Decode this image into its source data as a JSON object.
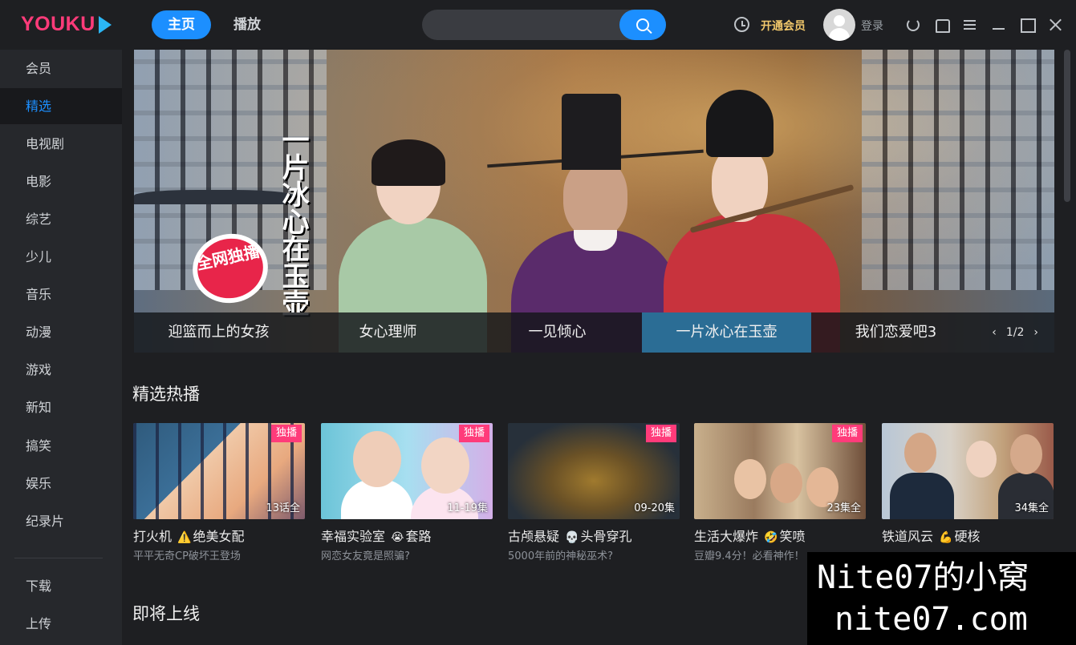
{
  "app": {
    "logo_text": "YOUKU",
    "nav": {
      "home": "主页",
      "play": "播放"
    },
    "vip_label": "开通会员",
    "login_label": "登录"
  },
  "sidebar": {
    "items": [
      "会员",
      "精选",
      "电视剧",
      "电影",
      "综艺",
      "少儿",
      "音乐",
      "动漫",
      "游戏",
      "新知",
      "搞笑",
      "娱乐",
      "纪录片"
    ],
    "active_index": 1,
    "bottom_items": [
      "下载",
      "上传"
    ]
  },
  "banner": {
    "title_art": "一片冰心在玉壶",
    "badge": "全网独播",
    "tabs": [
      "迎篮而上的女孩",
      "女心理师",
      "一见倾心",
      "一片冰心在玉壶",
      "我们恋爱吧3"
    ],
    "active_tab": 3,
    "page_indicator": "1/2",
    "prev_icon": "chevron-left-icon",
    "next_icon": "chevron-right-icon"
  },
  "sections": {
    "hot": "精选热播",
    "upcoming": "即将上线"
  },
  "cards": [
    {
      "tag": "独播",
      "episodes": "13话全",
      "title": "打火机",
      "emoji": "⚠️",
      "title_suffix": "绝美女配",
      "subtitle": "平平无奇CP破坏王登场"
    },
    {
      "tag": "独播",
      "episodes": "11-19集",
      "title": "幸福实验室",
      "emoji": "😭",
      "title_suffix": "套路",
      "subtitle": "网恋女友竟是照骗?"
    },
    {
      "tag": "独播",
      "episodes": "09-20集",
      "title": "古颅悬疑",
      "emoji": "💀",
      "title_suffix": "头骨穿孔",
      "subtitle": "5000年前的神秘巫术?"
    },
    {
      "tag": "独播",
      "episodes": "23集全",
      "title": "生活大爆炸",
      "emoji": "🤣",
      "title_suffix": "笑喷",
      "subtitle": "豆瓣9.4分！必看神作！"
    },
    {
      "tag": "",
      "episodes": "34集全",
      "title": "铁道风云",
      "emoji": "💪",
      "title_suffix": "硬核",
      "subtitle": ""
    }
  ],
  "watermark": {
    "line1": "Nite07的小窝",
    "line2": "nite07.com"
  },
  "colors": {
    "accent": "#1c8fff",
    "brand": "#ff3b7a",
    "vip": "#f2c86b"
  }
}
